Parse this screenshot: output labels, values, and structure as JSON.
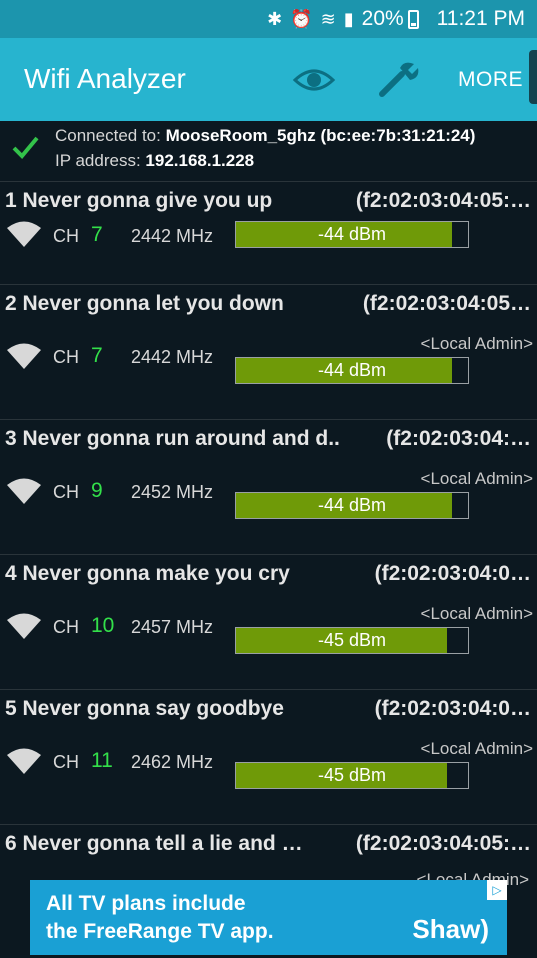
{
  "status_bar": {
    "battery": "20%",
    "time": "11:21 PM"
  },
  "app_bar": {
    "title": "Wifi Analyzer",
    "more_label": "MORE"
  },
  "connection": {
    "connected_prefix": "Connected to: ",
    "ssid": "MooseRoom_5ghz (bc:ee:7b:31:21:24)",
    "ip_prefix": "IP address: ",
    "ip": "192.168.1.228"
  },
  "access_points": [
    {
      "title": "1 Never gonna give you up",
      "mac": "(f2:02:03:04:05:…",
      "local": "",
      "ch_label": "CH",
      "channel": "7",
      "freq": "2442 MHz",
      "signal": "-44 dBm",
      "fill": 0.93
    },
    {
      "title": "2 Never gonna let you down",
      "mac": "(f2:02:03:04:05…",
      "local": "<Local Admin>",
      "ch_label": "CH",
      "channel": "7",
      "freq": "2442 MHz",
      "signal": "-44 dBm",
      "fill": 0.93
    },
    {
      "title": "3 Never gonna run around and d..",
      "mac": "(f2:02:03:04:…",
      "local": "<Local Admin>",
      "ch_label": "CH",
      "channel": "9",
      "freq": "2452 MHz",
      "signal": "-44 dBm",
      "fill": 0.93
    },
    {
      "title": "4 Never gonna make you cry",
      "mac": "(f2:02:03:04:0…",
      "local": "<Local Admin>",
      "ch_label": "CH",
      "channel": "10",
      "freq": "2457 MHz",
      "signal": "-45 dBm",
      "fill": 0.91
    },
    {
      "title": "5 Never gonna say goodbye",
      "mac": "(f2:02:03:04:0…",
      "local": "<Local Admin>",
      "ch_label": "CH",
      "channel": "11",
      "freq": "2462 MHz",
      "signal": "-45 dBm",
      "fill": 0.91
    },
    {
      "title": "6 Never gonna tell a lie and …",
      "mac": "(f2:02:03:04:05:…",
      "local": "",
      "ch_label": "",
      "channel": "",
      "freq": "",
      "signal": "",
      "fill": 0
    }
  ],
  "ad": {
    "line1": "All TV plans include",
    "line2": "the FreeRange TV app.",
    "brand": "Shaw)",
    "partial_label": "<Local Admin>"
  },
  "colors": {
    "appbar": "#27b4cf",
    "statusbar": "#1c95ad",
    "meter_fill": "#6f9a08",
    "channel": "#33e04a",
    "background": "#0c1820"
  }
}
